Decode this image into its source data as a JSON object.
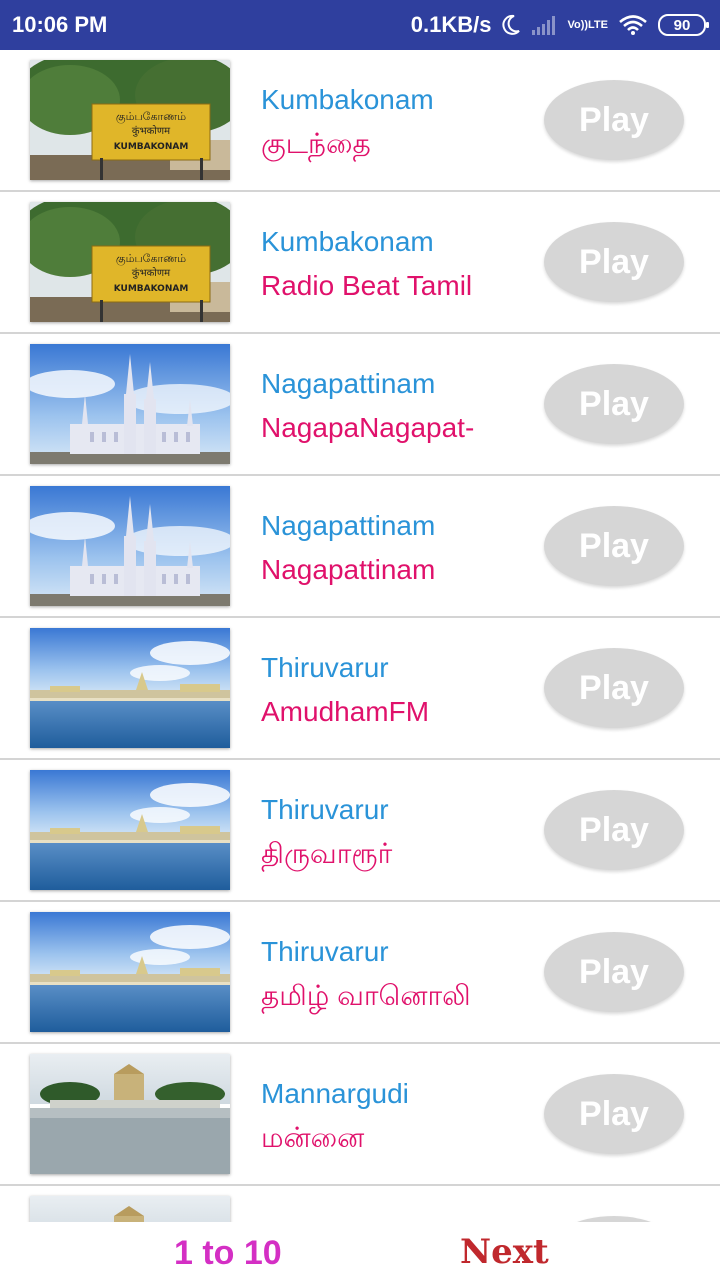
{
  "status_bar": {
    "time": "10:06 PM",
    "speed": "0.1KB/s",
    "lte_top": "Vo))",
    "lte_bottom": "LTE",
    "battery": "90",
    "icons": [
      "moon-icon",
      "signal-icon",
      "volte-icon",
      "wifi-icon",
      "battery-icon"
    ]
  },
  "stations": [
    {
      "district": "Kumbakonam",
      "name": "குடந்தை",
      "button": "Play",
      "thumbnail": "kumbakonam-station-sign"
    },
    {
      "district": "Kumbakonam",
      "name": "Radio Beat Tamil",
      "button": "Play",
      "thumbnail": "kumbakonam-station-sign"
    },
    {
      "district": "Nagapattinam",
      "name": "NagapaNagapat-",
      "button": "Play",
      "thumbnail": "velankanni-church"
    },
    {
      "district": "Nagapattinam",
      "name": "Nagapattinam",
      "button": "Play",
      "thumbnail": "velankanni-church"
    },
    {
      "district": "Thiruvarur",
      "name": "AmudhamFM",
      "button": "Play",
      "thumbnail": "thiruvarur-temple-tank"
    },
    {
      "district": "Thiruvarur",
      "name": "திருவாரூர்",
      "button": "Play",
      "thumbnail": "thiruvarur-temple-tank"
    },
    {
      "district": "Thiruvarur",
      "name": "தமிழ் வானொலி",
      "button": "Play",
      "thumbnail": "thiruvarur-temple-tank"
    },
    {
      "district": "Mannargudi",
      "name": "மன்னை",
      "button": "Play",
      "thumbnail": "mannargudi-temple-tank"
    }
  ],
  "sign_text": {
    "tamil": "கும்பகோணம்",
    "hindi": "कुंभकोणम",
    "english": "KUMBAKONAM"
  },
  "footer": {
    "page_indicator": "1 to 10",
    "next_label": "Next"
  },
  "colors": {
    "status_bar": "#2f3f9e",
    "district_text": "#2a93d8",
    "station_text": "#e0116b",
    "play_button": "#d6d6d6",
    "page_indicator": "#d42fc4",
    "next_button": "#c0282d"
  }
}
